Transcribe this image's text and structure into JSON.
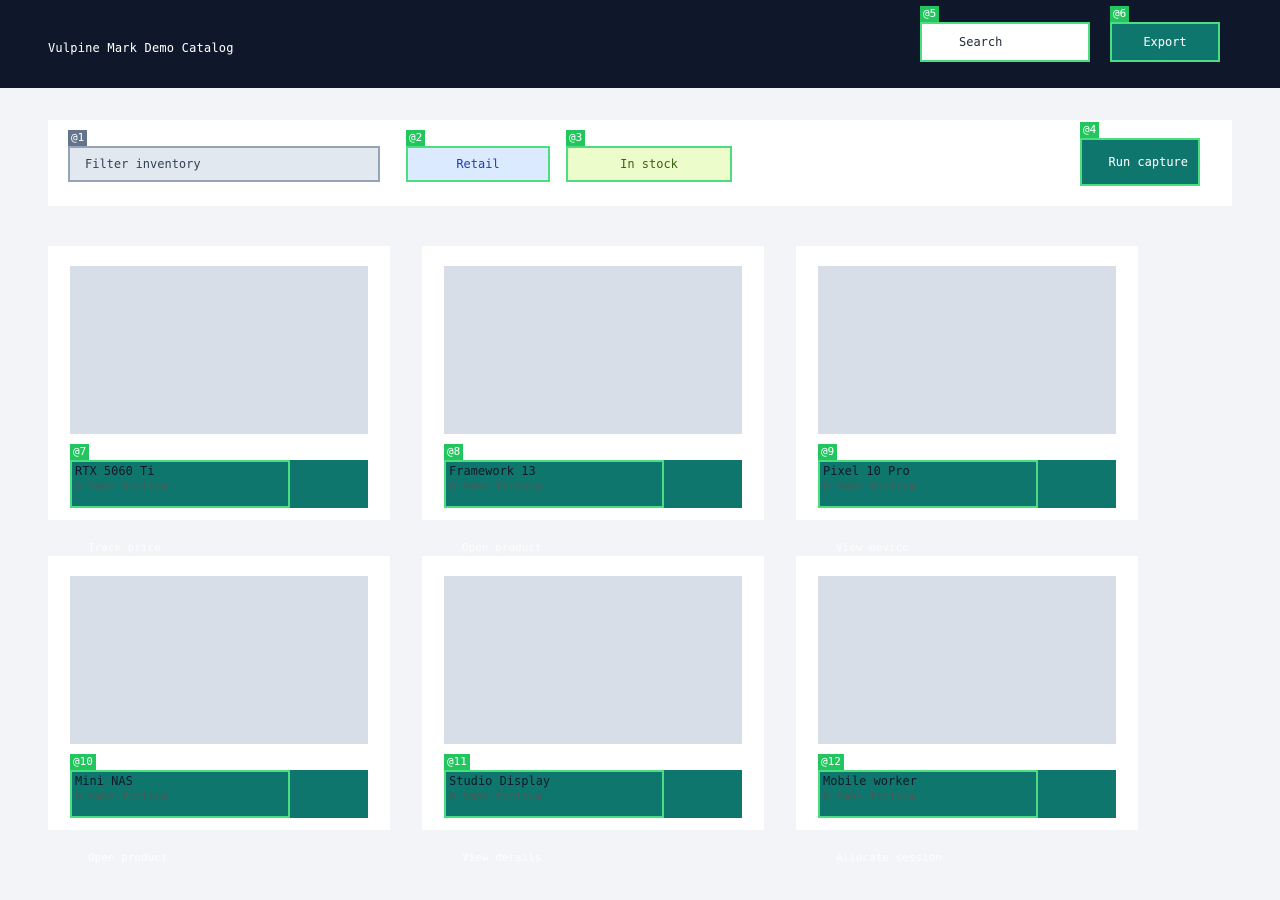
{
  "header": {
    "title": "Vulpine Mark Demo Catalog",
    "search_label": "Search",
    "search_mark": "@5",
    "export_label": "Export",
    "export_mark": "@6"
  },
  "toolbar": {
    "filter_placeholder": "Filter inventory",
    "filter_mark": "@1",
    "retail_label": "Retail",
    "retail_mark": "@2",
    "stock_label": "In stock",
    "stock_mark": "@3",
    "run_label": "Run capture",
    "run_mark": "@4"
  },
  "cards": [
    {
      "mark": "@7",
      "name": "RTX 5060 Ti",
      "meta": "0 Ambe forisum",
      "action": "Track price"
    },
    {
      "mark": "@8",
      "name": "Framework 13",
      "meta": "0 Ambe forisum",
      "action": "Open product"
    },
    {
      "mark": "@9",
      "name": "Pixel 10 Pro",
      "meta": "0 Ambe forisum",
      "action": "View device"
    },
    {
      "mark": "@10",
      "name": "Mini NAS",
      "meta": "0 Ambe forisum",
      "action": "Open product"
    },
    {
      "mark": "@11",
      "name": "Studio Display",
      "meta": "0 Ambe forisum",
      "action": "View details"
    },
    {
      "mark": "@12",
      "name": "Mobile worker",
      "meta": "0 Ambe forisum",
      "action": "Allocate session"
    }
  ],
  "colors": {
    "header_bg": "#0f172a",
    "accent": "#0f766e",
    "mark_outline": "#4ade80",
    "mark_badge": "#22c55e"
  }
}
